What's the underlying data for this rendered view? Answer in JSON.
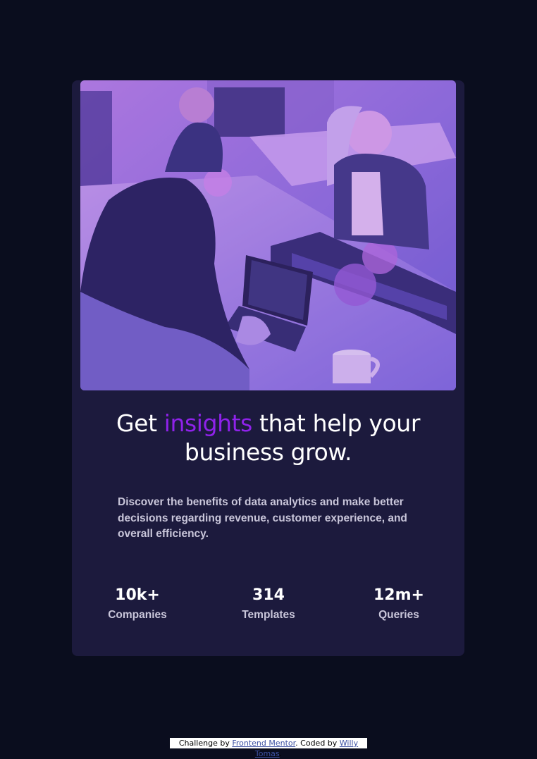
{
  "card": {
    "headline": {
      "before": "Get ",
      "accent": "insights",
      "after": " that help your business grow."
    },
    "description": "Discover the benefits of data analytics and make better decisions regarding revenue, customer experience, and overall efficiency.",
    "stats": [
      {
        "value": "10k+",
        "label": "Companies"
      },
      {
        "value": "314",
        "label": "Templates"
      },
      {
        "value": "12m+",
        "label": "Queries"
      }
    ]
  },
  "attribution": {
    "prefix": "Challenge by ",
    "link1": "Frontend Mentor",
    "middle": ". Coded by ",
    "link2": "Willy Tomas",
    "suffix": "."
  },
  "colors": {
    "page_background": "#0a0d1e",
    "card_background": "#1c1a3d",
    "accent": "#8f22ea",
    "image_tint": "#7a4fd8"
  }
}
